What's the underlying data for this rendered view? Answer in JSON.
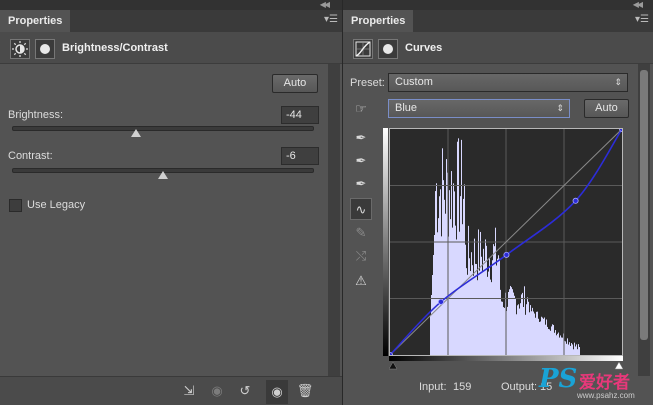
{
  "left_panel": {
    "tab_label": "Properties",
    "title": "Brightness/Contrast",
    "auto_label": "Auto",
    "brightness": {
      "label": "Brightness:",
      "value": "-44",
      "slider_fraction": 0.412
    },
    "contrast": {
      "label": "Contrast:",
      "value": "-6",
      "slider_fraction": 0.5
    },
    "use_legacy_label": "Use Legacy",
    "use_legacy_checked": false
  },
  "right_panel": {
    "tab_label": "Properties",
    "title": "Curves",
    "preset_label": "Preset:",
    "preset_value": "Custom",
    "channel_value": "Blue",
    "auto_label": "Auto",
    "input_label": "Input:",
    "input_value": "159",
    "output_label": "Output:",
    "output_value": "15"
  },
  "icons": {
    "left_header": [
      "brightness-contrast-icon",
      "layer-mask-icon"
    ],
    "right_header": [
      "curves-icon",
      "layer-mask-icon"
    ],
    "tools": [
      "on-image-adjust-icon",
      "black-point-eyedropper-icon",
      "gray-point-eyedropper-icon",
      "white-point-eyedropper-icon",
      "curve-points-icon",
      "pencil-icon",
      "smooth-icon",
      "clipping-warning-icon"
    ],
    "footer": [
      "clip-to-layer-icon",
      "view-previous-state-icon",
      "reset-icon",
      "toggle-visibility-icon",
      "delete-icon"
    ]
  },
  "colors": {
    "curve": "#2c2cd8",
    "histogram": "#d8d8ff",
    "panel_bg": "#535353"
  },
  "watermark": {
    "logo": "PS",
    "text": "爱好者",
    "url": "www.psahz.com"
  },
  "chart_data": {
    "type": "line",
    "xlim": [
      0,
      255
    ],
    "ylim": [
      0,
      255
    ],
    "grid": true,
    "series": [
      {
        "points": [
          [
            0,
            0
          ],
          [
            56,
            60
          ],
          [
            128,
            113
          ],
          [
            204,
            174
          ],
          [
            255,
            255
          ]
        ]
      }
    ],
    "baseline": [
      [
        0,
        0
      ],
      [
        255,
        255
      ]
    ]
  }
}
